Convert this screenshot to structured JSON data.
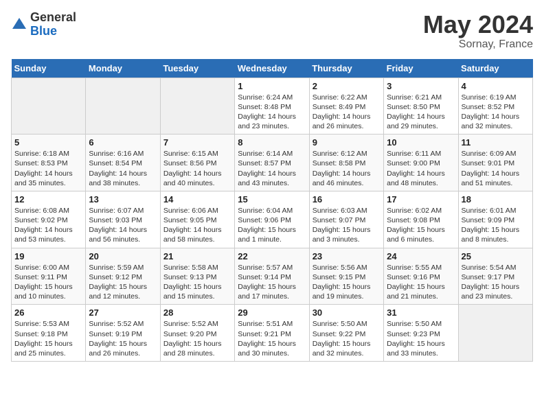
{
  "header": {
    "logo_general": "General",
    "logo_blue": "Blue",
    "title": "May 2024",
    "subtitle": "Sornay, France"
  },
  "weekdays": [
    "Sunday",
    "Monday",
    "Tuesday",
    "Wednesday",
    "Thursday",
    "Friday",
    "Saturday"
  ],
  "weeks": [
    [
      {
        "day": "",
        "sunrise": "",
        "sunset": "",
        "daylight": ""
      },
      {
        "day": "",
        "sunrise": "",
        "sunset": "",
        "daylight": ""
      },
      {
        "day": "",
        "sunrise": "",
        "sunset": "",
        "daylight": ""
      },
      {
        "day": "1",
        "sunrise": "Sunrise: 6:24 AM",
        "sunset": "Sunset: 8:48 PM",
        "daylight": "Daylight: 14 hours and 23 minutes."
      },
      {
        "day": "2",
        "sunrise": "Sunrise: 6:22 AM",
        "sunset": "Sunset: 8:49 PM",
        "daylight": "Daylight: 14 hours and 26 minutes."
      },
      {
        "day": "3",
        "sunrise": "Sunrise: 6:21 AM",
        "sunset": "Sunset: 8:50 PM",
        "daylight": "Daylight: 14 hours and 29 minutes."
      },
      {
        "day": "4",
        "sunrise": "Sunrise: 6:19 AM",
        "sunset": "Sunset: 8:52 PM",
        "daylight": "Daylight: 14 hours and 32 minutes."
      }
    ],
    [
      {
        "day": "5",
        "sunrise": "Sunrise: 6:18 AM",
        "sunset": "Sunset: 8:53 PM",
        "daylight": "Daylight: 14 hours and 35 minutes."
      },
      {
        "day": "6",
        "sunrise": "Sunrise: 6:16 AM",
        "sunset": "Sunset: 8:54 PM",
        "daylight": "Daylight: 14 hours and 38 minutes."
      },
      {
        "day": "7",
        "sunrise": "Sunrise: 6:15 AM",
        "sunset": "Sunset: 8:56 PM",
        "daylight": "Daylight: 14 hours and 40 minutes."
      },
      {
        "day": "8",
        "sunrise": "Sunrise: 6:14 AM",
        "sunset": "Sunset: 8:57 PM",
        "daylight": "Daylight: 14 hours and 43 minutes."
      },
      {
        "day": "9",
        "sunrise": "Sunrise: 6:12 AM",
        "sunset": "Sunset: 8:58 PM",
        "daylight": "Daylight: 14 hours and 46 minutes."
      },
      {
        "day": "10",
        "sunrise": "Sunrise: 6:11 AM",
        "sunset": "Sunset: 9:00 PM",
        "daylight": "Daylight: 14 hours and 48 minutes."
      },
      {
        "day": "11",
        "sunrise": "Sunrise: 6:09 AM",
        "sunset": "Sunset: 9:01 PM",
        "daylight": "Daylight: 14 hours and 51 minutes."
      }
    ],
    [
      {
        "day": "12",
        "sunrise": "Sunrise: 6:08 AM",
        "sunset": "Sunset: 9:02 PM",
        "daylight": "Daylight: 14 hours and 53 minutes."
      },
      {
        "day": "13",
        "sunrise": "Sunrise: 6:07 AM",
        "sunset": "Sunset: 9:03 PM",
        "daylight": "Daylight: 14 hours and 56 minutes."
      },
      {
        "day": "14",
        "sunrise": "Sunrise: 6:06 AM",
        "sunset": "Sunset: 9:05 PM",
        "daylight": "Daylight: 14 hours and 58 minutes."
      },
      {
        "day": "15",
        "sunrise": "Sunrise: 6:04 AM",
        "sunset": "Sunset: 9:06 PM",
        "daylight": "Daylight: 15 hours and 1 minute."
      },
      {
        "day": "16",
        "sunrise": "Sunrise: 6:03 AM",
        "sunset": "Sunset: 9:07 PM",
        "daylight": "Daylight: 15 hours and 3 minutes."
      },
      {
        "day": "17",
        "sunrise": "Sunrise: 6:02 AM",
        "sunset": "Sunset: 9:08 PM",
        "daylight": "Daylight: 15 hours and 6 minutes."
      },
      {
        "day": "18",
        "sunrise": "Sunrise: 6:01 AM",
        "sunset": "Sunset: 9:09 PM",
        "daylight": "Daylight: 15 hours and 8 minutes."
      }
    ],
    [
      {
        "day": "19",
        "sunrise": "Sunrise: 6:00 AM",
        "sunset": "Sunset: 9:11 PM",
        "daylight": "Daylight: 15 hours and 10 minutes."
      },
      {
        "day": "20",
        "sunrise": "Sunrise: 5:59 AM",
        "sunset": "Sunset: 9:12 PM",
        "daylight": "Daylight: 15 hours and 12 minutes."
      },
      {
        "day": "21",
        "sunrise": "Sunrise: 5:58 AM",
        "sunset": "Sunset: 9:13 PM",
        "daylight": "Daylight: 15 hours and 15 minutes."
      },
      {
        "day": "22",
        "sunrise": "Sunrise: 5:57 AM",
        "sunset": "Sunset: 9:14 PM",
        "daylight": "Daylight: 15 hours and 17 minutes."
      },
      {
        "day": "23",
        "sunrise": "Sunrise: 5:56 AM",
        "sunset": "Sunset: 9:15 PM",
        "daylight": "Daylight: 15 hours and 19 minutes."
      },
      {
        "day": "24",
        "sunrise": "Sunrise: 5:55 AM",
        "sunset": "Sunset: 9:16 PM",
        "daylight": "Daylight: 15 hours and 21 minutes."
      },
      {
        "day": "25",
        "sunrise": "Sunrise: 5:54 AM",
        "sunset": "Sunset: 9:17 PM",
        "daylight": "Daylight: 15 hours and 23 minutes."
      }
    ],
    [
      {
        "day": "26",
        "sunrise": "Sunrise: 5:53 AM",
        "sunset": "Sunset: 9:18 PM",
        "daylight": "Daylight: 15 hours and 25 minutes."
      },
      {
        "day": "27",
        "sunrise": "Sunrise: 5:52 AM",
        "sunset": "Sunset: 9:19 PM",
        "daylight": "Daylight: 15 hours and 26 minutes."
      },
      {
        "day": "28",
        "sunrise": "Sunrise: 5:52 AM",
        "sunset": "Sunset: 9:20 PM",
        "daylight": "Daylight: 15 hours and 28 minutes."
      },
      {
        "day": "29",
        "sunrise": "Sunrise: 5:51 AM",
        "sunset": "Sunset: 9:21 PM",
        "daylight": "Daylight: 15 hours and 30 minutes."
      },
      {
        "day": "30",
        "sunrise": "Sunrise: 5:50 AM",
        "sunset": "Sunset: 9:22 PM",
        "daylight": "Daylight: 15 hours and 32 minutes."
      },
      {
        "day": "31",
        "sunrise": "Sunrise: 5:50 AM",
        "sunset": "Sunset: 9:23 PM",
        "daylight": "Daylight: 15 hours and 33 minutes."
      },
      {
        "day": "",
        "sunrise": "",
        "sunset": "",
        "daylight": ""
      }
    ]
  ]
}
